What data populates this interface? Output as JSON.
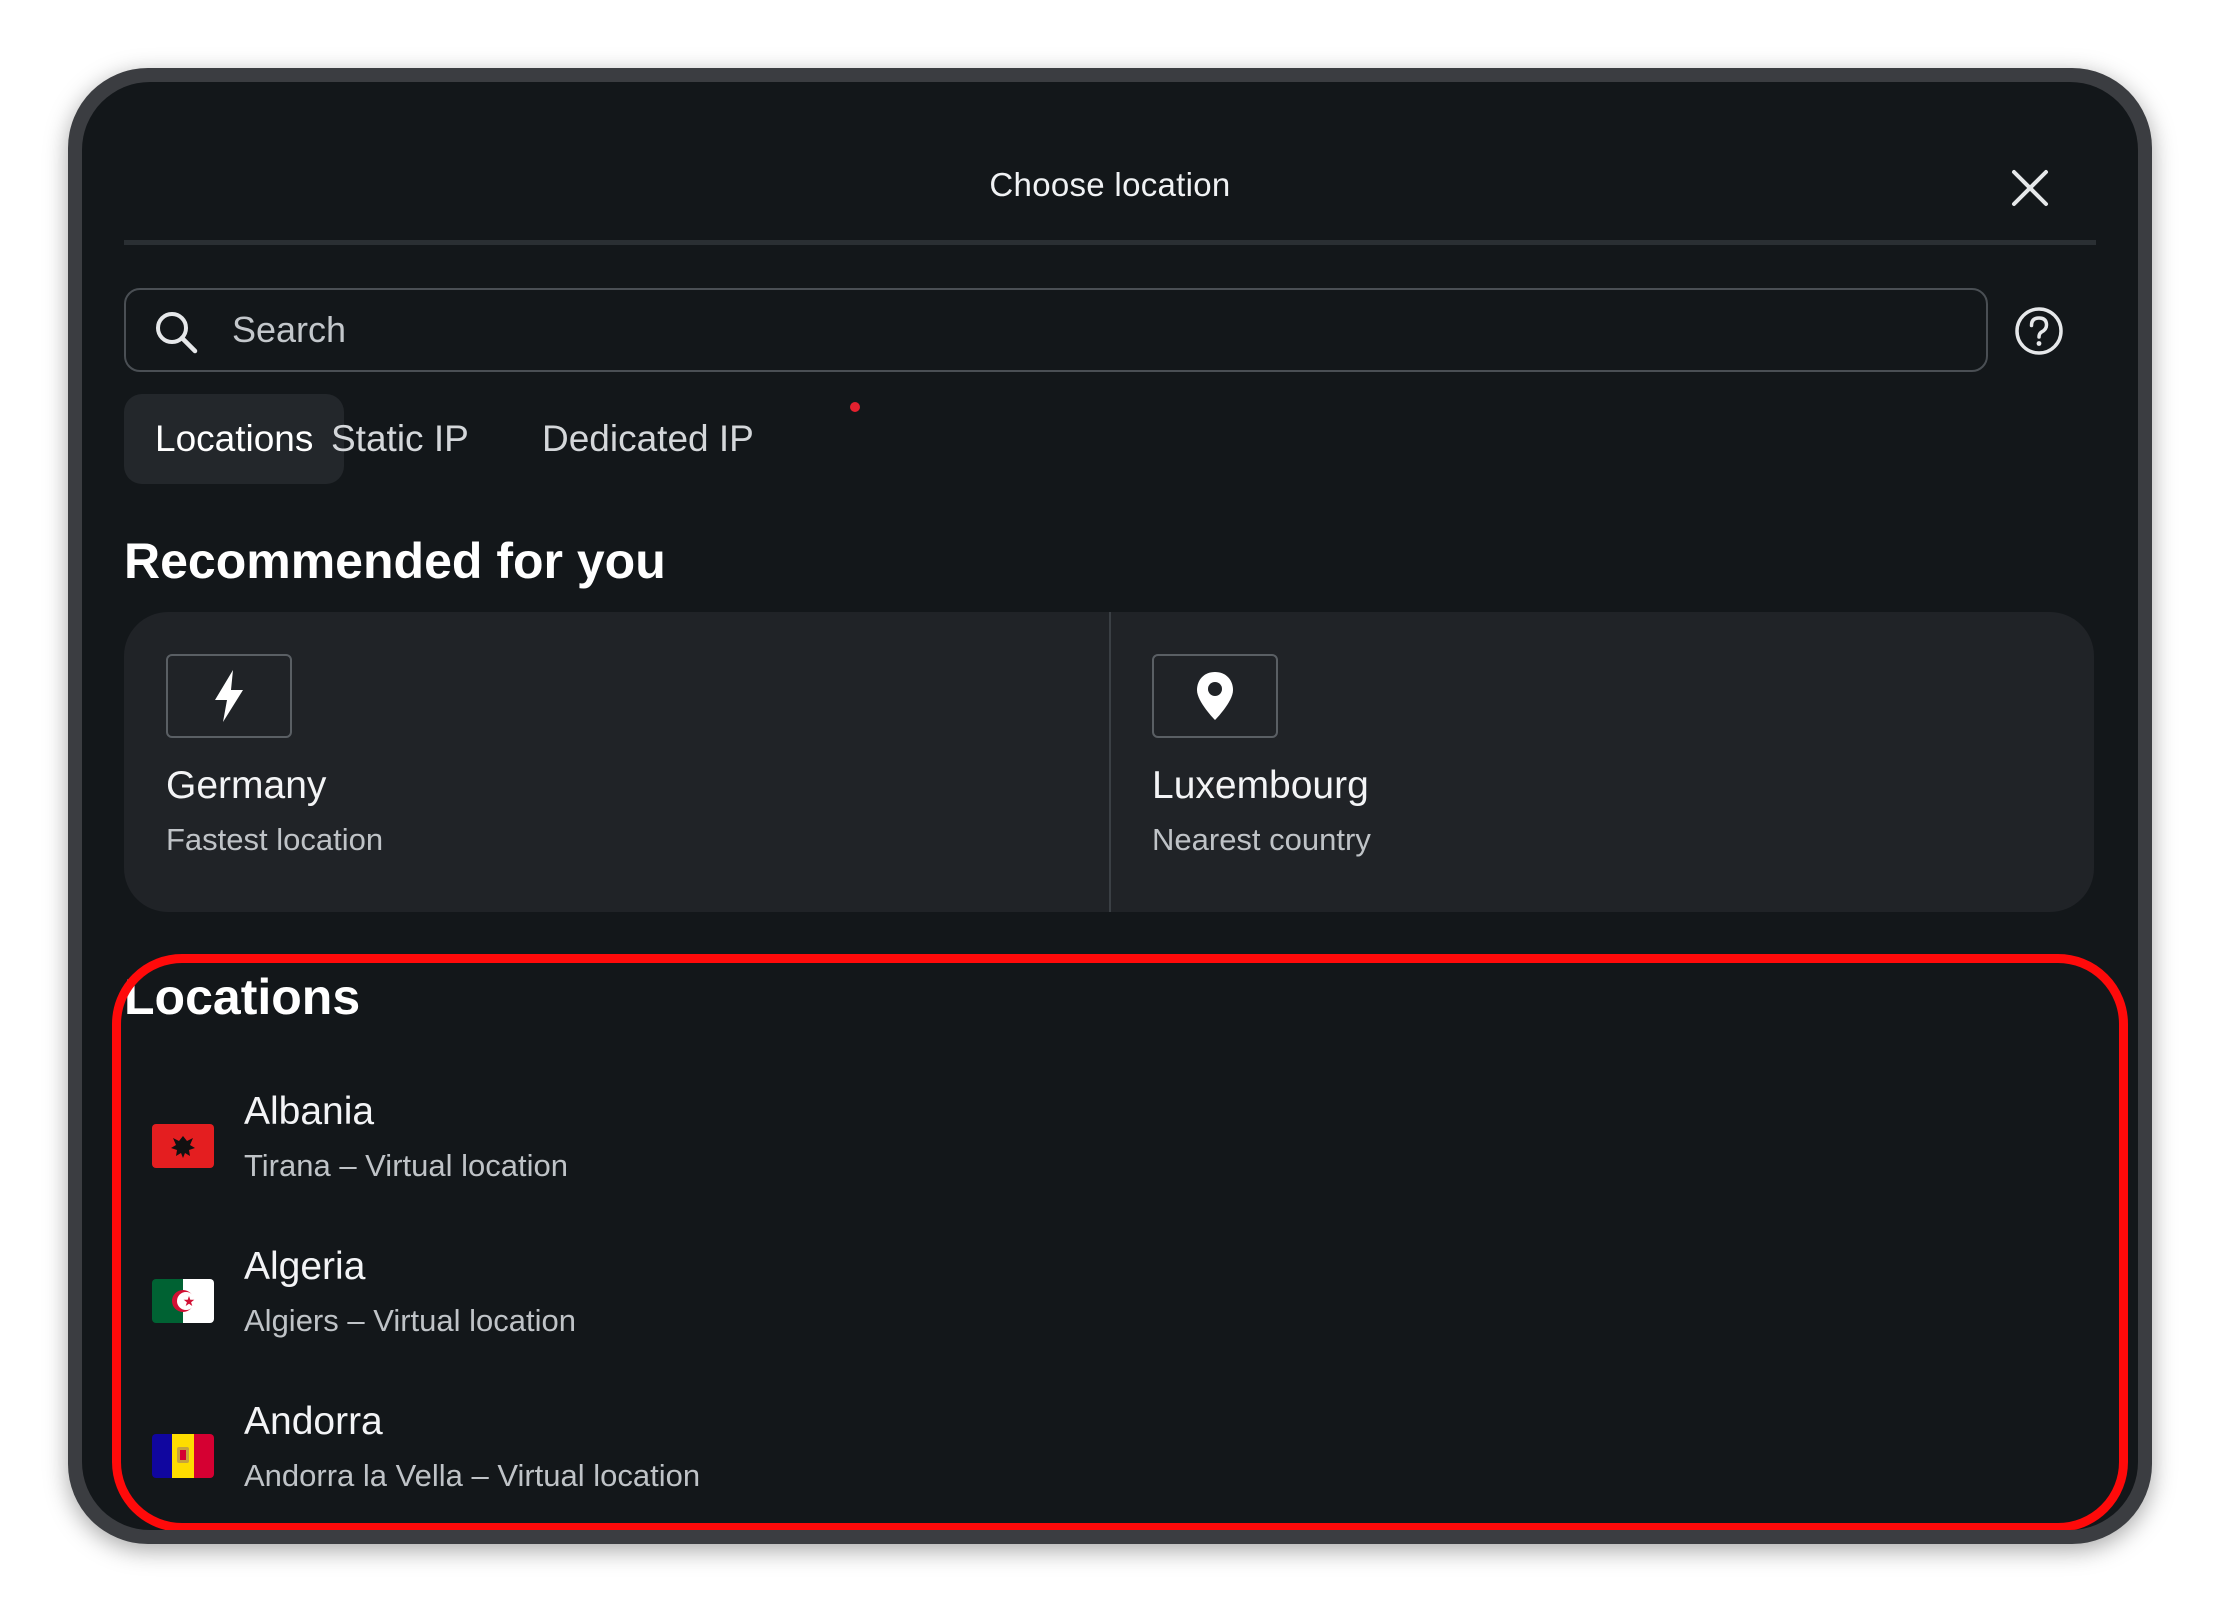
{
  "dialog": {
    "title": "Choose location",
    "close_icon": "close-icon",
    "help_icon": "help-circle-icon"
  },
  "search": {
    "placeholder": "Search",
    "value": "",
    "icon": "search-icon"
  },
  "tabs": [
    {
      "label": "Locations",
      "active": true
    },
    {
      "label": "Static IP",
      "active": false
    },
    {
      "label": "Dedicated IP",
      "active": false,
      "notification_dot": true
    }
  ],
  "recommended": {
    "heading": "Recommended for you",
    "items": [
      {
        "icon": "lightning-bolt-icon",
        "name": "Germany",
        "subtitle": "Fastest location"
      },
      {
        "icon": "map-pin-icon",
        "name": "Luxembourg",
        "subtitle": "Nearest country"
      }
    ]
  },
  "locations": {
    "heading": "Locations",
    "items": [
      {
        "flag": "albania-flag-icon",
        "name": "Albania",
        "subtitle": "Tirana – Virtual location"
      },
      {
        "flag": "algeria-flag-icon",
        "name": "Algeria",
        "subtitle": "Algiers – Virtual location"
      },
      {
        "flag": "andorra-flag-icon",
        "name": "Andorra",
        "subtitle": "Andorra la Vella – Virtual location"
      }
    ]
  },
  "colors": {
    "background": "#13171a",
    "card": "#202327",
    "highlight": "#ff0a0a",
    "notification_dot": "#e5212f"
  }
}
